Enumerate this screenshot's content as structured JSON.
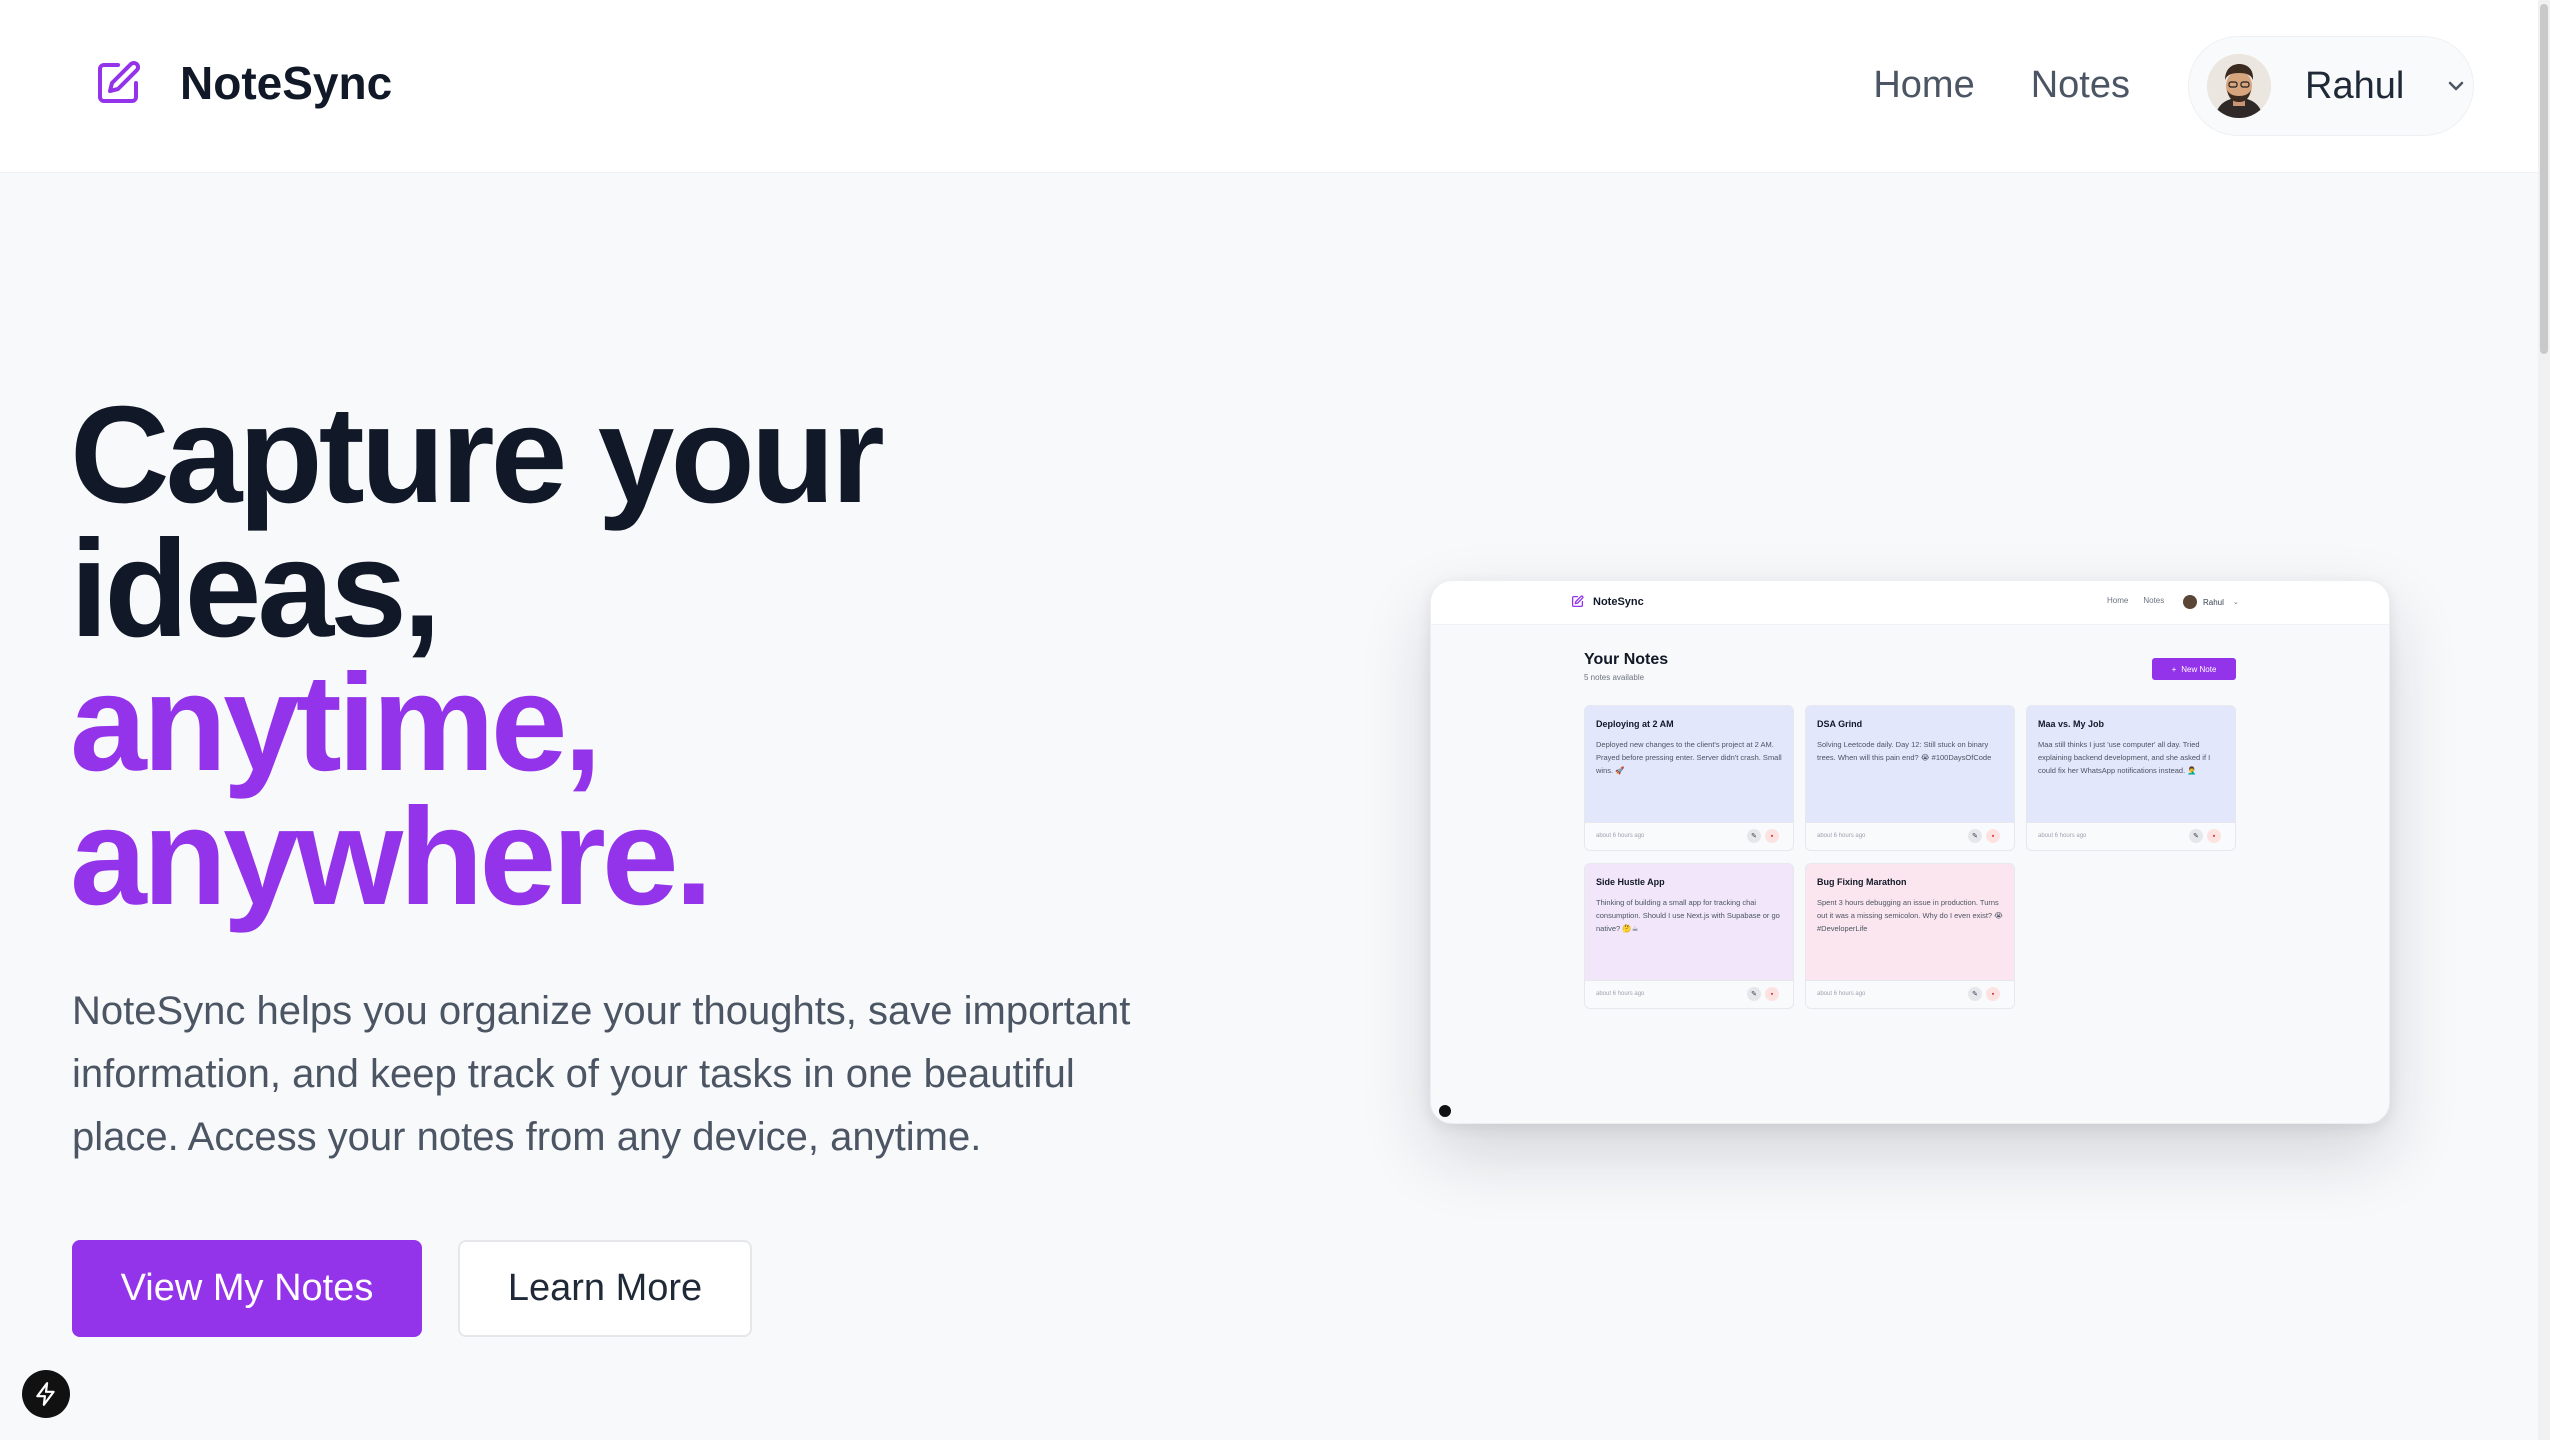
{
  "brand": {
    "name": "NoteSync"
  },
  "nav": {
    "home": "Home",
    "notes": "Notes"
  },
  "user": {
    "name": "Rahul"
  },
  "hero": {
    "title_line1": "Capture your",
    "title_line2": "ideas,",
    "title_line3": "anytime,",
    "title_line4": "anywhere.",
    "description": "NoteSync helps you organize your thoughts, save important information, and keep track of your tasks in one beautiful place. Access your notes from any device, anytime.",
    "primary_button": "View My Notes",
    "secondary_button": "Learn More"
  },
  "preview": {
    "brand": "NoteSync",
    "nav_home": "Home",
    "nav_notes": "Notes",
    "user": "Rahul",
    "heading": "Your Notes",
    "subheading": "5 notes available",
    "new_note_button": "New Note",
    "notes": [
      {
        "title": "Deploying at 2 AM",
        "body": "Deployed new changes to the client's project at 2 AM. Prayed before pressing enter. Server didn't crash. Small wins. 🚀",
        "time": "about 6 hours ago"
      },
      {
        "title": "DSA Grind",
        "body": "Solving Leetcode daily. Day 12: Still stuck on binary trees. When will this pain end? 😭 #100DaysOfCode",
        "time": "about 6 hours ago"
      },
      {
        "title": "Maa vs. My Job",
        "body": "Maa still thinks I just 'use computer' all day. Tried explaining backend development, and she asked if I could fix her WhatsApp notifications instead. 🤦‍♂️",
        "time": "about 6 hours ago"
      },
      {
        "title": "Side Hustle App",
        "body": "Thinking of building a small app for tracking chai consumption. Should I use Next.js with Supabase or go native? 🤔☕",
        "time": "about 6 hours ago"
      },
      {
        "title": "Bug Fixing Marathon",
        "body": "Spent 3 hours debugging an issue in production. Turns out it was a missing semicolon. Why do I even exist? 😭 #DeveloperLife",
        "time": "about 6 hours ago"
      }
    ]
  },
  "colors": {
    "accent": "#9333ea",
    "heading": "#111827",
    "body_text": "#4b5563",
    "background": "#f8f9fb"
  },
  "icons": {
    "logo": "edit-square-icon",
    "user_menu": "chevron-down-icon",
    "dev_badge": "lightning-bolt-icon"
  }
}
